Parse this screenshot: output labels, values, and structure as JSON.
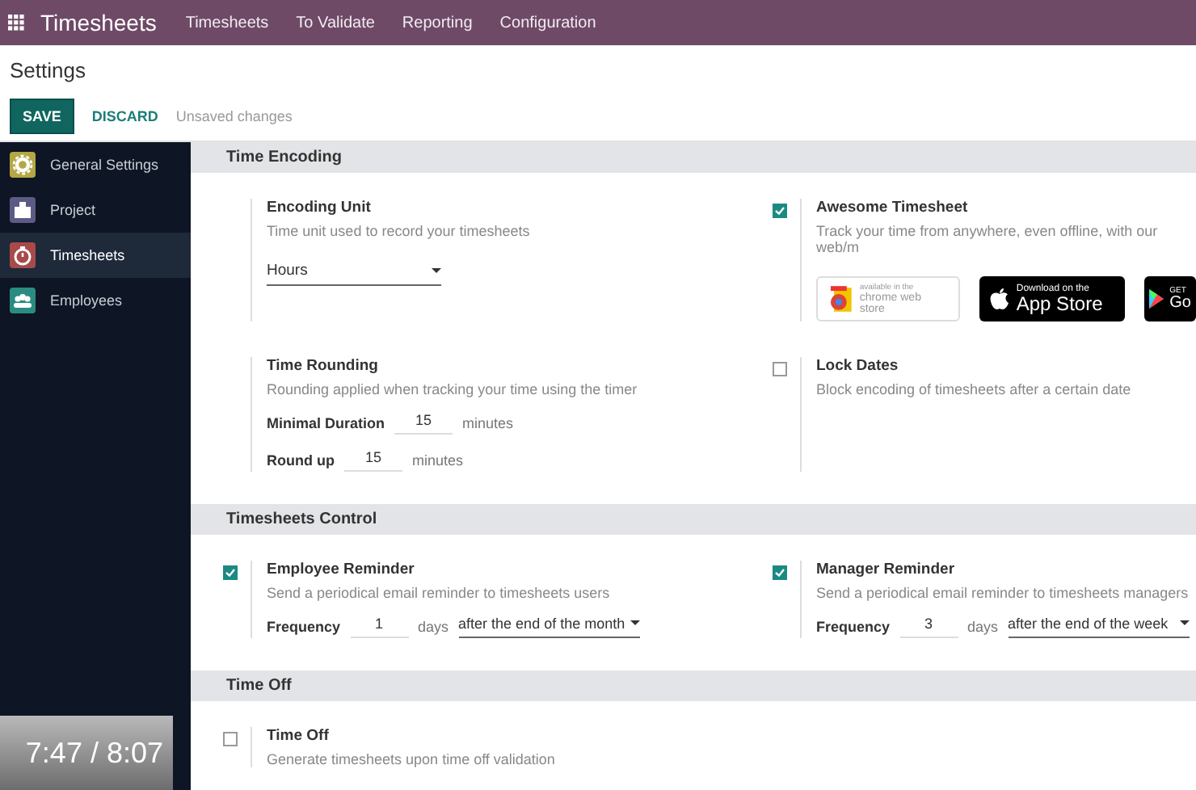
{
  "nav": {
    "app_title": "Timesheets",
    "menu": [
      "Timesheets",
      "To Validate",
      "Reporting",
      "Configuration"
    ]
  },
  "header": {
    "title": "Settings",
    "save": "SAVE",
    "discard": "DISCARD",
    "status": "Unsaved changes"
  },
  "sidebar": {
    "items": [
      {
        "label": "General Settings",
        "color": "#b3a843",
        "selected": false
      },
      {
        "label": "Project",
        "color": "#5e5a86",
        "selected": false
      },
      {
        "label": "Timesheets",
        "color": "#a84a4a",
        "selected": true
      },
      {
        "label": "Employees",
        "color": "#2a8c80",
        "selected": false
      }
    ]
  },
  "sections": [
    {
      "title": "Time Encoding",
      "settings": [
        {
          "kind": "select",
          "title": "Encoding Unit",
          "description": "Time unit used to record your timesheets",
          "value": "Hours"
        },
        {
          "kind": "badges",
          "checked": true,
          "title": "Awesome Timesheet",
          "description": "Track your time from anywhere, even offline, with our web/m",
          "badges": [
            {
              "kind": "chrome",
              "line1": "available in the",
              "line2": "chrome web store"
            },
            {
              "kind": "apple",
              "line1": "Download on the",
              "line2": "App Store"
            },
            {
              "kind": "google",
              "line1": "GET",
              "line2": "Go"
            }
          ]
        },
        {
          "kind": "durations",
          "title": "Time Rounding",
          "description": "Rounding applied when tracking your time using the timer",
          "fields": [
            {
              "label": "Minimal Duration",
              "value": "15",
              "unit": "minutes"
            },
            {
              "label": "Round up",
              "value": "15",
              "unit": "minutes"
            }
          ]
        },
        {
          "kind": "plain",
          "checked": false,
          "title": "Lock Dates",
          "description": "Block encoding of timesheets after a certain date"
        }
      ]
    },
    {
      "title": "Timesheets Control",
      "settings": [
        {
          "kind": "reminder",
          "checked": true,
          "title": "Employee Reminder",
          "description": "Send a periodical email reminder to timesheets users",
          "label": "Frequency",
          "value": "1",
          "unit": "days",
          "period": "after the end of the month"
        },
        {
          "kind": "reminder",
          "checked": true,
          "title": "Manager Reminder",
          "description": "Send a periodical email reminder to timesheets managers",
          "label": "Frequency",
          "value": "3",
          "unit": "days",
          "period": "after the end of the week"
        }
      ]
    },
    {
      "title": "Time Off",
      "settings": [
        {
          "kind": "plain",
          "checked": false,
          "title": "Time Off",
          "description": "Generate timesheets upon time off validation"
        }
      ]
    }
  ],
  "video": {
    "time": "7:47 / 8:07"
  }
}
